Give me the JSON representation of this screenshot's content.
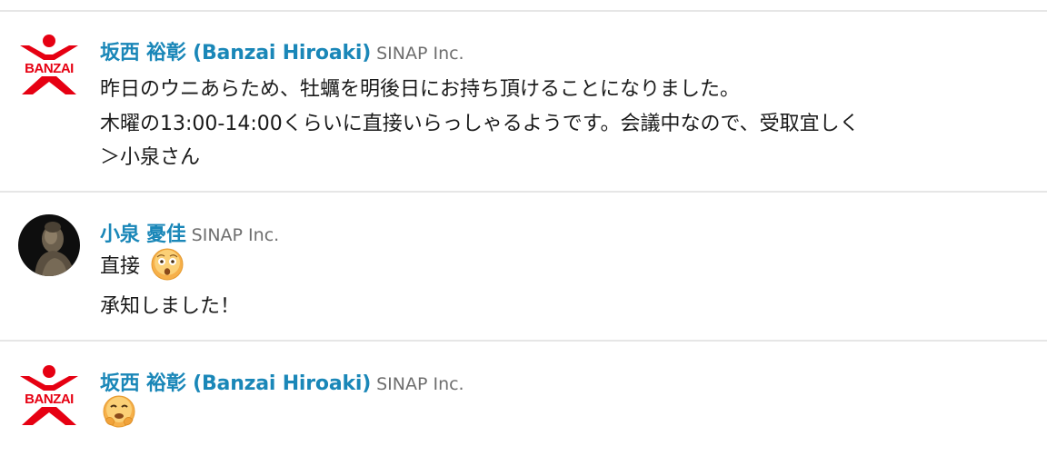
{
  "messages": [
    {
      "author": "坂西 裕彰 (Banzai Hiroaki)",
      "org": "SINAP Inc.",
      "avatar": "banzai-logo",
      "avatar_text": "BANZAI",
      "lines": [
        "昨日のウニあらため、牡蠣を明後日にお持ち頂けることになりました。",
        "木曜の13:00-14:00くらいに直接いらっしゃるようです。会議中なので、受取宜しく",
        "＞小泉さん"
      ]
    },
    {
      "author": "小泉 憂佳",
      "org": "SINAP Inc.",
      "avatar": "buddha-statue-photo",
      "lines": [
        "直接",
        "承知しました！"
      ],
      "emoji": "surprised-face-emoji"
    },
    {
      "author": "坂西 裕彰 (Banzai Hiroaki)",
      "org": "SINAP Inc.",
      "avatar": "banzai-logo",
      "avatar_text": "BANZAI",
      "emoji": "fearful-face-emoji"
    }
  ],
  "colors": {
    "author": "#1a87b8",
    "org": "#6e6e6e",
    "divider": "#e6e6e6",
    "banzai_red": "#e60012"
  }
}
